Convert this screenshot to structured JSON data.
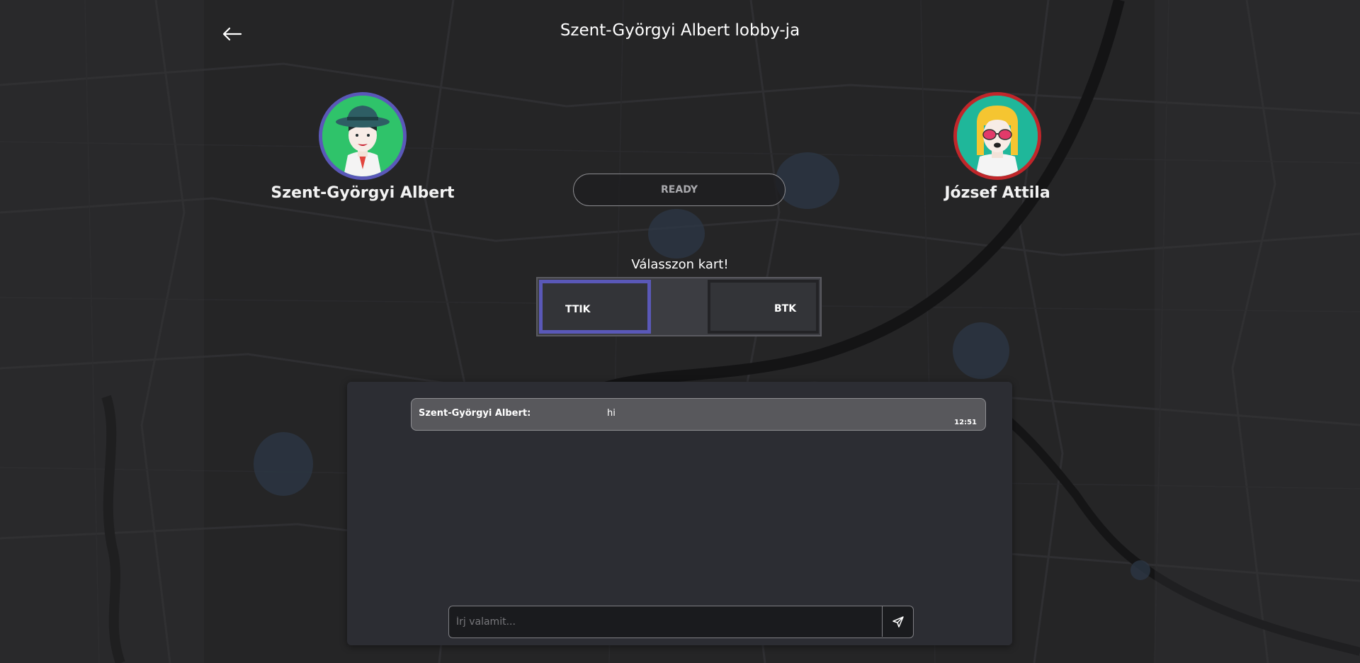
{
  "header": {
    "title": "Szent-Györgyi Albert lobby-ja",
    "back_icon": "arrow-left-icon"
  },
  "players": {
    "left": {
      "name": "Szent-Györgyi Albert",
      "ring_color": "#5a58b8"
    },
    "right": {
      "name": "József Attila",
      "ring_color": "#c0262a"
    }
  },
  "ready": {
    "label": "READY"
  },
  "card_choice": {
    "prompt": "Válasszon kart!",
    "options": [
      {
        "label": "TTIK",
        "selected": true
      },
      {
        "label": "BTK",
        "selected": false
      }
    ],
    "selected_color": "#5a58b8"
  },
  "chat": {
    "messages": [
      {
        "author": "Szent-Györgyi Albert:",
        "text": "hi",
        "time": "12:51"
      }
    ],
    "input_placeholder": "Írj valamit...",
    "send_icon": "send-icon"
  }
}
